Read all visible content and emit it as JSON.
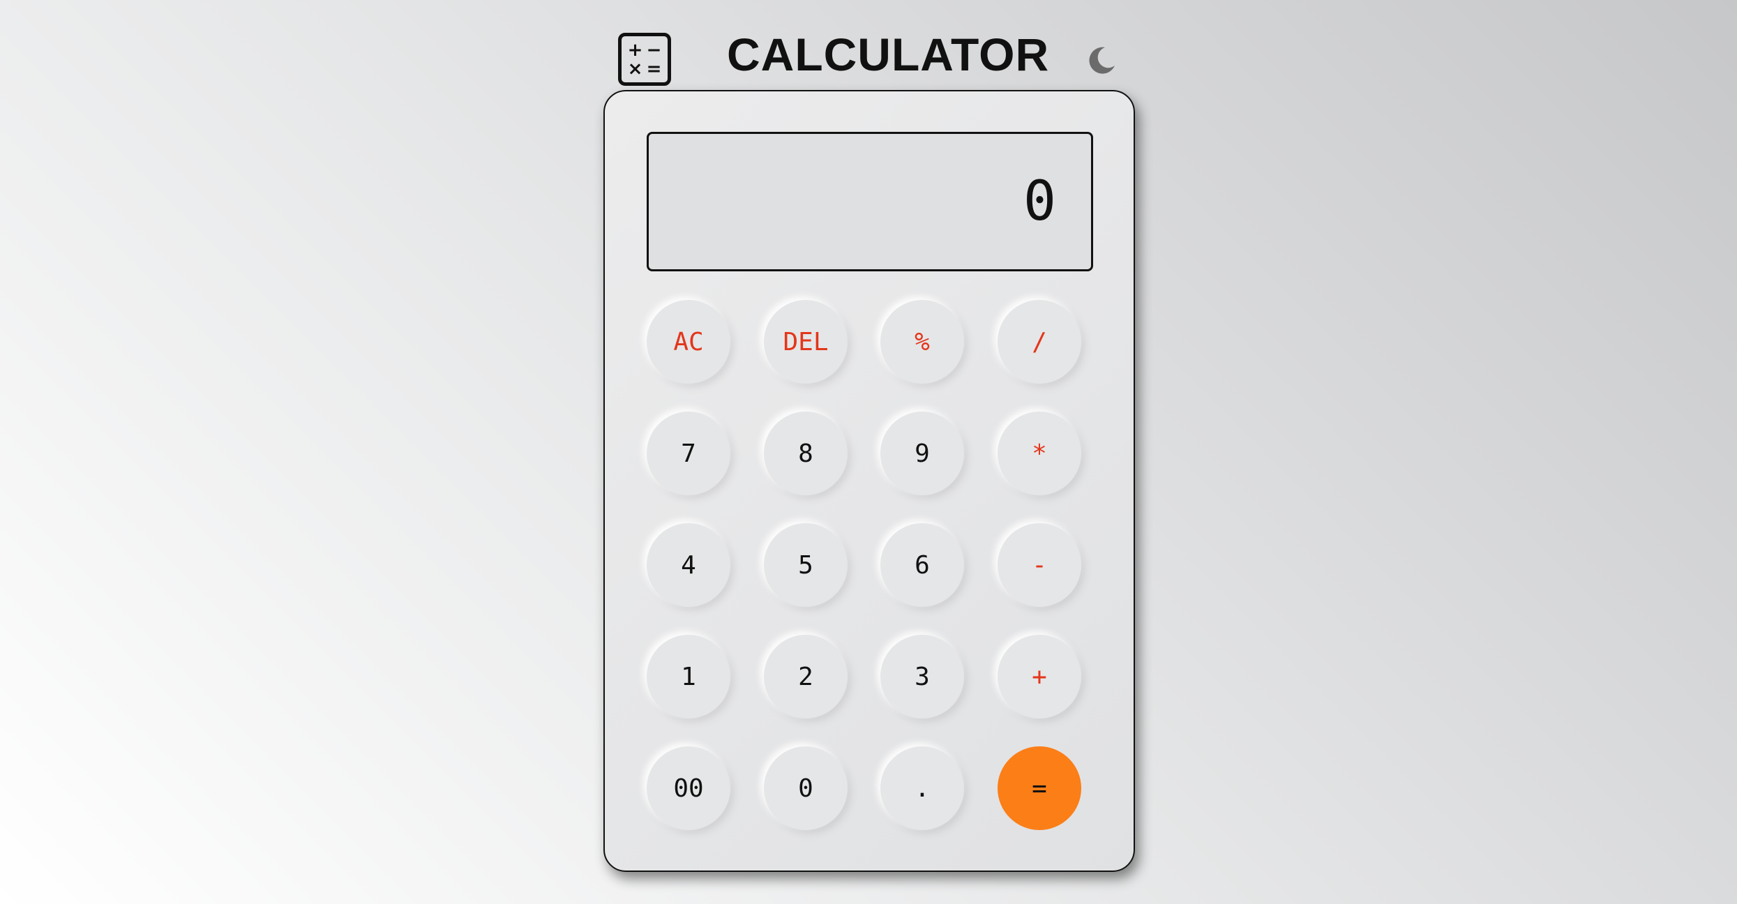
{
  "header": {
    "icon_symbols": [
      "+",
      "−",
      "×",
      "="
    ],
    "title": "CALCULATOR",
    "theme_icon": "moon-icon"
  },
  "display": {
    "value": "0"
  },
  "keys": [
    {
      "label": "AC",
      "name": "clear",
      "type": "op"
    },
    {
      "label": "DEL",
      "name": "delete",
      "type": "op"
    },
    {
      "label": "%",
      "name": "percent",
      "type": "op"
    },
    {
      "label": "/",
      "name": "divide",
      "type": "op"
    },
    {
      "label": "7",
      "name": "digit-7",
      "type": "num"
    },
    {
      "label": "8",
      "name": "digit-8",
      "type": "num"
    },
    {
      "label": "9",
      "name": "digit-9",
      "type": "num"
    },
    {
      "label": "*",
      "name": "multiply",
      "type": "op"
    },
    {
      "label": "4",
      "name": "digit-4",
      "type": "num"
    },
    {
      "label": "5",
      "name": "digit-5",
      "type": "num"
    },
    {
      "label": "6",
      "name": "digit-6",
      "type": "num"
    },
    {
      "label": "-",
      "name": "subtract",
      "type": "op"
    },
    {
      "label": "1",
      "name": "digit-1",
      "type": "num"
    },
    {
      "label": "2",
      "name": "digit-2",
      "type": "num"
    },
    {
      "label": "3",
      "name": "digit-3",
      "type": "num"
    },
    {
      "label": "+",
      "name": "add",
      "type": "op"
    },
    {
      "label": "00",
      "name": "digit-00",
      "type": "num"
    },
    {
      "label": "0",
      "name": "digit-0",
      "type": "num"
    },
    {
      "label": ".",
      "name": "decimal",
      "type": "num"
    },
    {
      "label": "=",
      "name": "equals",
      "type": "equals"
    }
  ],
  "colors": {
    "operator_text": "#e3361b",
    "equals_background": "#fb7e17",
    "text": "#111111"
  }
}
